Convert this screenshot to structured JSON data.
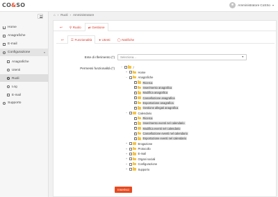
{
  "header": {
    "logo_text_dark": "CO",
    "logo_text_accent": "&",
    "logo_text_end": "SO",
    "user_name": "Amministratore CoSSo"
  },
  "sidebar": {
    "items": [
      {
        "label": "Home",
        "icon": "home-icon"
      },
      {
        "label": "Anagrafiche",
        "icon": "box-icon"
      },
      {
        "label": "E-mail",
        "icon": "mail-icon"
      },
      {
        "label": "Configurazione",
        "icon": "gear-icon"
      },
      {
        "label": "Anagrafiche",
        "icon": "box-icon"
      },
      {
        "label": "Utenti",
        "icon": "user-icon"
      },
      {
        "label": "Ruoli",
        "icon": "gear-icon"
      },
      {
        "label": "Log",
        "icon": "clock-icon"
      },
      {
        "label": "E-mail",
        "icon": "mail-icon"
      },
      {
        "label": "Supporto",
        "icon": "support-icon"
      }
    ]
  },
  "breadcrumb": {
    "home": "Ruoli",
    "sep": "›",
    "current": "Amministratore"
  },
  "top_tabs": [
    {
      "label": "",
      "icon": "back-icon"
    },
    {
      "label": "Ruolo",
      "icon": "pin-icon"
    },
    {
      "label": "Gestione",
      "icon": "shuffle-icon"
    }
  ],
  "sub_tabs": [
    {
      "label": "",
      "icon": "back-icon"
    },
    {
      "label": "Funzionalità",
      "icon": "list-icon"
    },
    {
      "label": "Utenti",
      "icon": "user-icon"
    },
    {
      "label": "Notifiche",
      "icon": "bell-icon"
    }
  ],
  "form": {
    "ente_label": "Ente di riferimento (*)",
    "ente_placeholder": "Seleziona...",
    "permessi_label": "Permessi funzionalità (*)"
  },
  "tree": [
    {
      "label": "/",
      "depth": 0,
      "exp": "−",
      "checked": false,
      "hl": false
    },
    {
      "label": "Home",
      "depth": 1,
      "exp": "+",
      "checked": false,
      "hl": false
    },
    {
      "label": "Anagrafiche",
      "depth": 1,
      "exp": "−",
      "checked": false,
      "hl": false
    },
    {
      "label": "Ricerca",
      "depth": 2,
      "exp": "",
      "checked": true,
      "hl": true
    },
    {
      "label": "Inserimento anagrafica",
      "depth": 2,
      "exp": "",
      "checked": true,
      "hl": true
    },
    {
      "label": "Modifica anagrafica",
      "depth": 2,
      "exp": "",
      "checked": true,
      "hl": true
    },
    {
      "label": "Cancellazione anagrafica",
      "depth": 2,
      "exp": "",
      "checked": true,
      "hl": true
    },
    {
      "label": "Esportazione anagrafica",
      "depth": 2,
      "exp": "",
      "checked": true,
      "hl": true
    },
    {
      "label": "Gestione allegati anagrafica",
      "depth": 2,
      "exp": "",
      "checked": true,
      "hl": true
    },
    {
      "label": "Calendario",
      "depth": 1,
      "exp": "−",
      "checked": false,
      "hl": false
    },
    {
      "label": "Ricerca",
      "depth": 2,
      "exp": "",
      "checked": true,
      "hl": true
    },
    {
      "label": "Inserimento eventi nel calendario",
      "depth": 2,
      "exp": "",
      "checked": true,
      "hl": true
    },
    {
      "label": "Modifica eventi nel calendario",
      "depth": 2,
      "exp": "",
      "checked": true,
      "hl": true
    },
    {
      "label": "Cancellazione eventi nel calendario",
      "depth": 2,
      "exp": "",
      "checked": true,
      "hl": true
    },
    {
      "label": "Esportazione eventi nel calendario",
      "depth": 2,
      "exp": "",
      "checked": true,
      "hl": true
    },
    {
      "label": "Erogazione",
      "depth": 1,
      "exp": "+",
      "checked": false,
      "hl": false
    },
    {
      "label": "Protocollo",
      "depth": 1,
      "exp": "+",
      "checked": false,
      "hl": false
    },
    {
      "label": "E-mail",
      "depth": 1,
      "exp": "+",
      "checked": false,
      "hl": false
    },
    {
      "label": "Organi sociali",
      "depth": 1,
      "exp": "+",
      "checked": false,
      "hl": false
    },
    {
      "label": "Configurazione",
      "depth": 1,
      "exp": "+",
      "checked": false,
      "hl": false
    },
    {
      "label": "Supporto",
      "depth": 1,
      "exp": "+",
      "checked": false,
      "hl": false
    }
  ],
  "buttons": {
    "insert_label": "Inserisci"
  }
}
